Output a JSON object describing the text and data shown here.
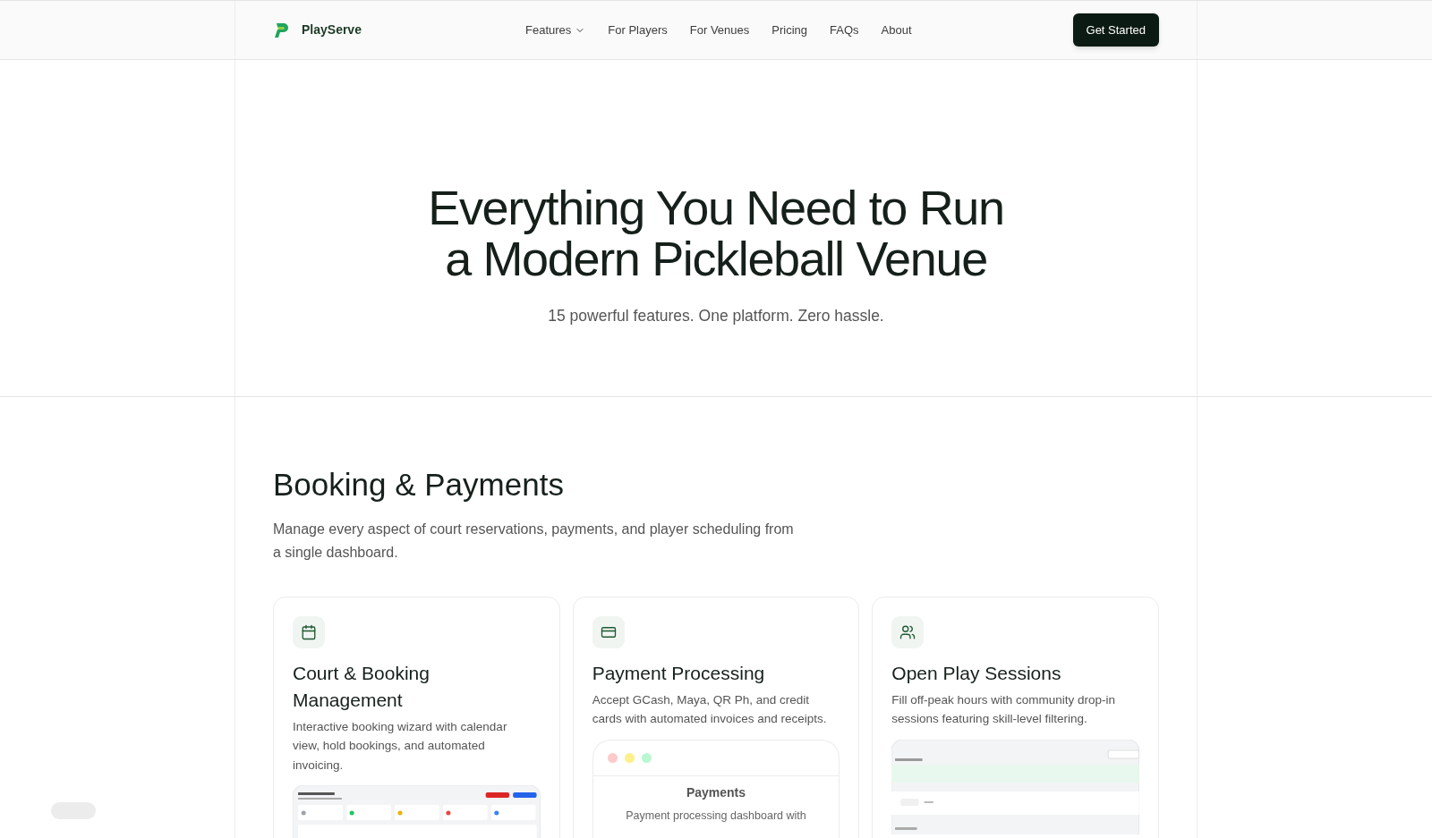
{
  "brand": {
    "name": "PlayServe"
  },
  "nav": [
    {
      "label": "Features",
      "dropdown": true
    },
    {
      "label": "For Players",
      "dropdown": false
    },
    {
      "label": "For Venues",
      "dropdown": false
    },
    {
      "label": "Pricing",
      "dropdown": false
    },
    {
      "label": "FAQs",
      "dropdown": false
    },
    {
      "label": "About",
      "dropdown": false
    }
  ],
  "cta": "Get Started",
  "hero": {
    "title_lines": [
      "Everything You Need to Run",
      "a Modern Pickleball Venue"
    ],
    "subtitle": "15 powerful features. One platform. Zero hassle."
  },
  "section": {
    "title": "Booking & Payments",
    "description": "Manage every aspect of court reservations, payments, and player scheduling from a single dashboard."
  },
  "cards": [
    {
      "title": "Court & Booking Management",
      "text": "Interactive booking wizard with calendar view, hold bookings, and automated invoicing.",
      "preview": {
        "kind": "bookings"
      }
    },
    {
      "title": "Payment Processing",
      "text": "Accept GCash, Maya, QR Ph, and credit cards with automated invoices and receipts.",
      "preview": {
        "kind": "window",
        "title": "Payments",
        "caption": "Payment processing dashboard with"
      }
    },
    {
      "title": "Open Play Sessions",
      "text": "Fill off-peak hours with community drop-in sessions featuring skill-level filtering.",
      "preview": {
        "kind": "sessions"
      }
    }
  ]
}
